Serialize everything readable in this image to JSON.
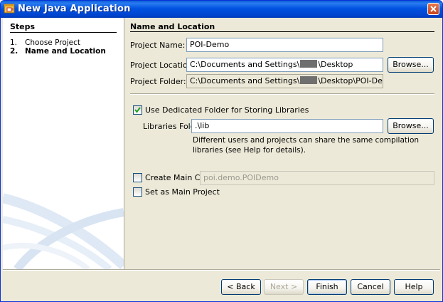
{
  "window": {
    "title": "New Java Application"
  },
  "steps": {
    "title": "Steps",
    "items": [
      {
        "num": "1.",
        "label": "Choose Project"
      },
      {
        "num": "2.",
        "label": "Name and Location"
      }
    ]
  },
  "section": {
    "title": "Name and Location"
  },
  "project_name": {
    "label": "Project Name:",
    "value": "POI-Demo"
  },
  "project_location": {
    "label": "Project Location:",
    "value_prefix": "C:\\Documents and Settings\\",
    "value_suffix": "\\Desktop",
    "browse": "Browse..."
  },
  "project_folder": {
    "label": "Project Folder:",
    "value_prefix": "C:\\Documents and Settings\\",
    "value_suffix": "\\Desktop\\POI-Demo"
  },
  "libraries": {
    "checkbox_label": "Use Dedicated Folder for Storing Libraries",
    "checked": true,
    "folder_label": "Libraries Folder:",
    "folder_value": ".\\lib",
    "browse": "Browse...",
    "hint_line1": "Different users and projects can share the same compilation",
    "hint_line2": "libraries (see Help for details)."
  },
  "main_class": {
    "label": "Create Main Class",
    "checked": false,
    "value": "poi.demo.POIDemo"
  },
  "set_main": {
    "label": "Set as Main Project",
    "checked": false
  },
  "buttons": {
    "back": "< Back",
    "next": "Next >",
    "finish": "Finish",
    "cancel": "Cancel",
    "help": "Help"
  },
  "colors": {
    "titlebar": "#0053e1",
    "dialog_bg": "#ece9d8",
    "field_border": "#7f9db9"
  }
}
